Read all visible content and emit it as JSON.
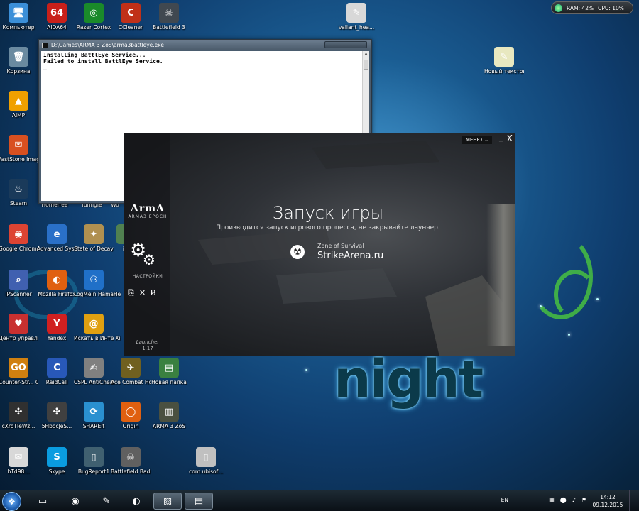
{
  "desktop": {
    "icons": [
      {
        "label": "Компьютер",
        "glyph": "🖥",
        "color": "#3b8fd8"
      },
      {
        "label": "AIDA64",
        "glyph": "64",
        "color": "#c8201a"
      },
      {
        "label": "Razer Cortex",
        "glyph": "◎",
        "color": "#1a8a2a"
      },
      {
        "label": "CCleaner",
        "glyph": "C",
        "color": "#c03018"
      },
      {
        "label": "Battlefield 3",
        "glyph": "☠",
        "color": "#404850"
      },
      {
        "label": "valiant_hea...",
        "glyph": "✎",
        "color": "#d8d8d8"
      },
      {
        "label": "Корзина",
        "glyph": "🗑",
        "color": "#6a8aa0"
      },
      {
        "label": "Новый текстов...",
        "glyph": "✎",
        "color": "#e8e8c0"
      },
      {
        "label": "AIMP",
        "glyph": "▲",
        "color": "#f0a000"
      },
      {
        "label": "FastStone Image Viewer",
        "glyph": "✉",
        "color": "#d85020"
      },
      {
        "label": "Steam",
        "glyph": "♨",
        "color": "#1a3a5a"
      },
      {
        "label": "Google Chrome",
        "glyph": "◉",
        "color": "#dd4433"
      },
      {
        "label": "Advanced SystemCare 9",
        "glyph": "e",
        "color": "#2a70c8"
      },
      {
        "label": "State of Decay",
        "glyph": "✦",
        "color": "#b09050"
      },
      {
        "label": "iYo",
        "glyph": "i",
        "color": "#508050"
      },
      {
        "label": "IPScanner",
        "glyph": "⌕",
        "color": "#4060b0"
      },
      {
        "label": "Mozilla Firefox",
        "glyph": "◐",
        "color": "#e06010"
      },
      {
        "label": "LogMeIn Hamachi",
        "glyph": "⚇",
        "color": "#2070c8"
      },
      {
        "label": "Центр управлен...",
        "glyph": "♥",
        "color": "#c83030"
      },
      {
        "label": "Yandex",
        "glyph": "Y",
        "color": "#d02020"
      },
      {
        "label": "Искать в Интернете",
        "glyph": "@",
        "color": "#e0a010"
      },
      {
        "label": "Counter-Str... Global Offe...",
        "glyph": "GO",
        "color": "#d08010"
      },
      {
        "label": "RaidCall",
        "glyph": "C",
        "color": "#2858b8"
      },
      {
        "label": "CSPL AntiCheat",
        "glyph": "✍",
        "color": "#808080"
      },
      {
        "label": "Ace Combat Horizon",
        "glyph": "✈",
        "color": "#706020"
      },
      {
        "label": "Новая папка",
        "glyph": "▤",
        "color": "#3a8040"
      },
      {
        "label": "cXroTIeWz...",
        "glyph": "✣",
        "color": "#303030"
      },
      {
        "label": "5HbocJeS...",
        "glyph": "✣",
        "color": "#404040"
      },
      {
        "label": "SHAREit",
        "glyph": "⟳",
        "color": "#2a90d0"
      },
      {
        "label": "Origin",
        "glyph": "◯",
        "color": "#e06010"
      },
      {
        "label": "ARMA 3 ZoS",
        "glyph": "▥",
        "color": "#4a5040"
      },
      {
        "label": "bTd98...",
        "glyph": "✉",
        "color": "#d8d8d8"
      },
      {
        "label": "Skype",
        "glyph": "S",
        "color": "#0a9ce0"
      },
      {
        "label": "BugReport1",
        "glyph": "▯",
        "color": "#406070"
      },
      {
        "label": "Battlefield Bad Com...",
        "glyph": "☠",
        "color": "#606060"
      },
      {
        "label": "com.ubisof...",
        "glyph": "▯",
        "color": "#c0c0c0"
      }
    ],
    "partial_labels": [
      "Homefree",
      "Tunngle",
      "Wo",
      "He",
      "Xi"
    ]
  },
  "sysmon": {
    "ram": "RAM: 42%",
    "cpu": "CPU: 10%"
  },
  "console": {
    "title": "D:\\Games\\ARMA 3 ZoS\\arma3battleye.exe",
    "lines": [
      "Installing BattlEye Service...",
      "Failed to install BattlEye Service.",
      "_"
    ]
  },
  "launcher": {
    "menu_label": "МЕНЮ",
    "brand_logo": "ArmA",
    "brand_sub": "ARMA3 EPOCH",
    "settings_label": "НАСТРОЙКИ",
    "launcher_label": "Launcher",
    "version": "1.17",
    "title": "Запуск игры",
    "subtitle": "Производится запуск игрового процесса, не закрывайте лаунчер.",
    "server_name": "Zone of Survival",
    "server_site": "StrikeArena.ru"
  },
  "taskbar": {
    "lang": "EN",
    "time": "14:12",
    "date": "09.12.2015"
  },
  "wallpaper": {
    "word": "night"
  }
}
